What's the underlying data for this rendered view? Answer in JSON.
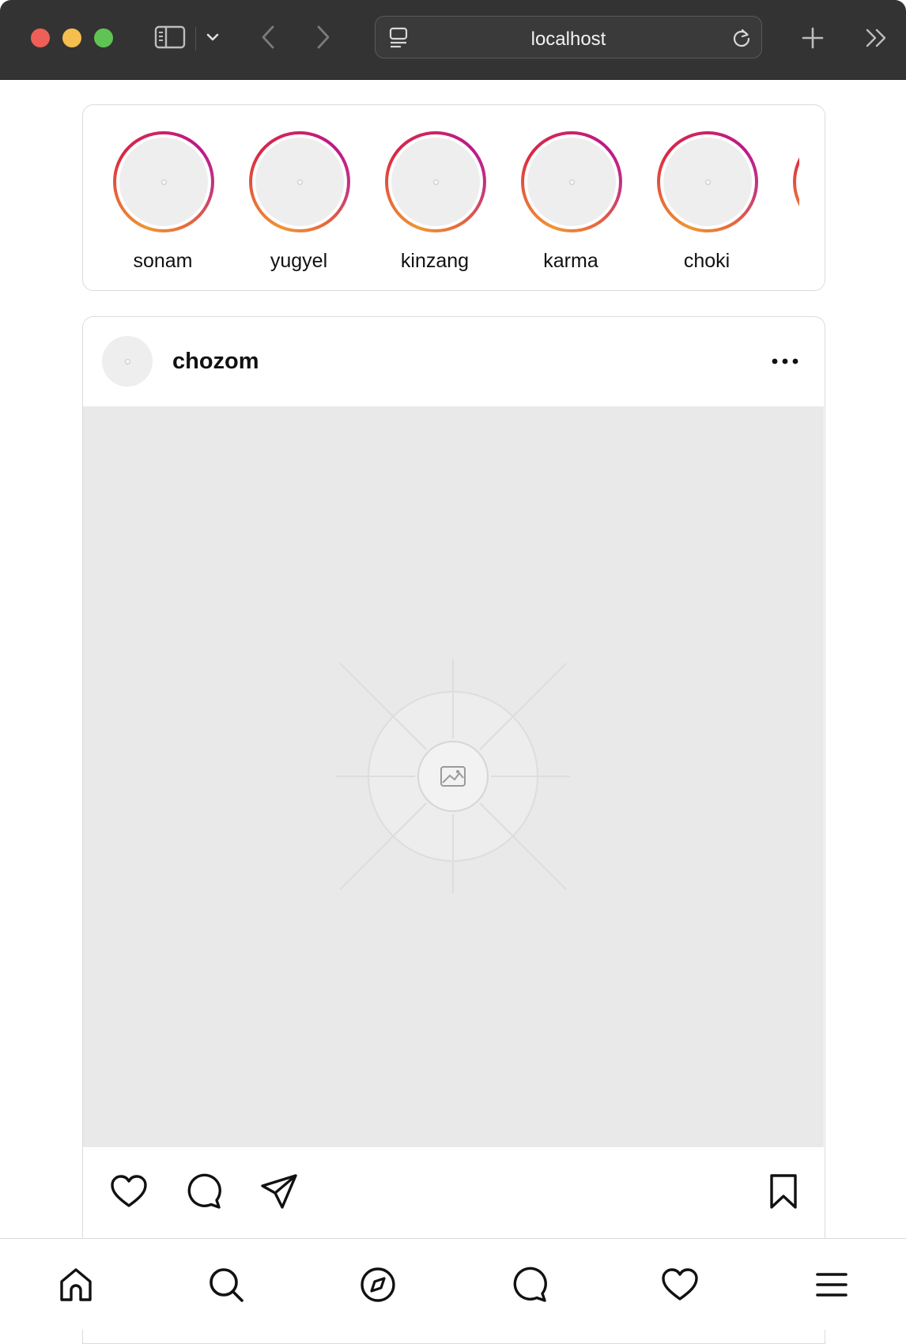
{
  "browser": {
    "address": "localhost"
  },
  "stories": [
    {
      "username": "sonam"
    },
    {
      "username": "yugyel"
    },
    {
      "username": "kinzang"
    },
    {
      "username": "karma"
    },
    {
      "username": "choki"
    }
  ],
  "post": {
    "username": "chozom"
  },
  "colors": {
    "chrome_bg": "#333333",
    "story_ring_start": "#f09433",
    "story_ring_end": "#bc1888",
    "placeholder": "#e9e9e9",
    "border": "#dbdbdb"
  },
  "icons": {
    "post_actions": [
      "heart-icon",
      "comment-icon",
      "share-icon",
      "bookmark-icon"
    ],
    "bottom_nav": [
      "home-icon",
      "search-icon",
      "explore-icon",
      "messages-icon",
      "notifications-icon",
      "menu-icon"
    ]
  }
}
